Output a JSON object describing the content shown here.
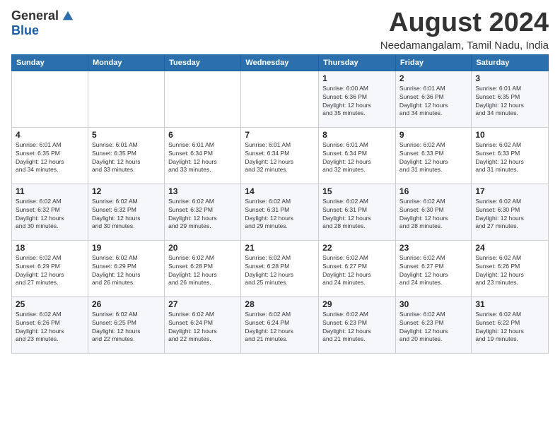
{
  "header": {
    "logo_general": "General",
    "logo_blue": "Blue",
    "month": "August 2024",
    "location": "Needamangalam, Tamil Nadu, India"
  },
  "weekdays": [
    "Sunday",
    "Monday",
    "Tuesday",
    "Wednesday",
    "Thursday",
    "Friday",
    "Saturday"
  ],
  "weeks": [
    [
      {
        "day": "",
        "info": ""
      },
      {
        "day": "",
        "info": ""
      },
      {
        "day": "",
        "info": ""
      },
      {
        "day": "",
        "info": ""
      },
      {
        "day": "1",
        "info": "Sunrise: 6:00 AM\nSunset: 6:36 PM\nDaylight: 12 hours\nand 35 minutes."
      },
      {
        "day": "2",
        "info": "Sunrise: 6:01 AM\nSunset: 6:36 PM\nDaylight: 12 hours\nand 34 minutes."
      },
      {
        "day": "3",
        "info": "Sunrise: 6:01 AM\nSunset: 6:35 PM\nDaylight: 12 hours\nand 34 minutes."
      }
    ],
    [
      {
        "day": "4",
        "info": "Sunrise: 6:01 AM\nSunset: 6:35 PM\nDaylight: 12 hours\nand 34 minutes."
      },
      {
        "day": "5",
        "info": "Sunrise: 6:01 AM\nSunset: 6:35 PM\nDaylight: 12 hours\nand 33 minutes."
      },
      {
        "day": "6",
        "info": "Sunrise: 6:01 AM\nSunset: 6:34 PM\nDaylight: 12 hours\nand 33 minutes."
      },
      {
        "day": "7",
        "info": "Sunrise: 6:01 AM\nSunset: 6:34 PM\nDaylight: 12 hours\nand 32 minutes."
      },
      {
        "day": "8",
        "info": "Sunrise: 6:01 AM\nSunset: 6:34 PM\nDaylight: 12 hours\nand 32 minutes."
      },
      {
        "day": "9",
        "info": "Sunrise: 6:02 AM\nSunset: 6:33 PM\nDaylight: 12 hours\nand 31 minutes."
      },
      {
        "day": "10",
        "info": "Sunrise: 6:02 AM\nSunset: 6:33 PM\nDaylight: 12 hours\nand 31 minutes."
      }
    ],
    [
      {
        "day": "11",
        "info": "Sunrise: 6:02 AM\nSunset: 6:32 PM\nDaylight: 12 hours\nand 30 minutes."
      },
      {
        "day": "12",
        "info": "Sunrise: 6:02 AM\nSunset: 6:32 PM\nDaylight: 12 hours\nand 30 minutes."
      },
      {
        "day": "13",
        "info": "Sunrise: 6:02 AM\nSunset: 6:32 PM\nDaylight: 12 hours\nand 29 minutes."
      },
      {
        "day": "14",
        "info": "Sunrise: 6:02 AM\nSunset: 6:31 PM\nDaylight: 12 hours\nand 29 minutes."
      },
      {
        "day": "15",
        "info": "Sunrise: 6:02 AM\nSunset: 6:31 PM\nDaylight: 12 hours\nand 28 minutes."
      },
      {
        "day": "16",
        "info": "Sunrise: 6:02 AM\nSunset: 6:30 PM\nDaylight: 12 hours\nand 28 minutes."
      },
      {
        "day": "17",
        "info": "Sunrise: 6:02 AM\nSunset: 6:30 PM\nDaylight: 12 hours\nand 27 minutes."
      }
    ],
    [
      {
        "day": "18",
        "info": "Sunrise: 6:02 AM\nSunset: 6:29 PM\nDaylight: 12 hours\nand 27 minutes."
      },
      {
        "day": "19",
        "info": "Sunrise: 6:02 AM\nSunset: 6:29 PM\nDaylight: 12 hours\nand 26 minutes."
      },
      {
        "day": "20",
        "info": "Sunrise: 6:02 AM\nSunset: 6:28 PM\nDaylight: 12 hours\nand 26 minutes."
      },
      {
        "day": "21",
        "info": "Sunrise: 6:02 AM\nSunset: 6:28 PM\nDaylight: 12 hours\nand 25 minutes."
      },
      {
        "day": "22",
        "info": "Sunrise: 6:02 AM\nSunset: 6:27 PM\nDaylight: 12 hours\nand 24 minutes."
      },
      {
        "day": "23",
        "info": "Sunrise: 6:02 AM\nSunset: 6:27 PM\nDaylight: 12 hours\nand 24 minutes."
      },
      {
        "day": "24",
        "info": "Sunrise: 6:02 AM\nSunset: 6:26 PM\nDaylight: 12 hours\nand 23 minutes."
      }
    ],
    [
      {
        "day": "25",
        "info": "Sunrise: 6:02 AM\nSunset: 6:26 PM\nDaylight: 12 hours\nand 23 minutes."
      },
      {
        "day": "26",
        "info": "Sunrise: 6:02 AM\nSunset: 6:25 PM\nDaylight: 12 hours\nand 22 minutes."
      },
      {
        "day": "27",
        "info": "Sunrise: 6:02 AM\nSunset: 6:24 PM\nDaylight: 12 hours\nand 22 minutes."
      },
      {
        "day": "28",
        "info": "Sunrise: 6:02 AM\nSunset: 6:24 PM\nDaylight: 12 hours\nand 21 minutes."
      },
      {
        "day": "29",
        "info": "Sunrise: 6:02 AM\nSunset: 6:23 PM\nDaylight: 12 hours\nand 21 minutes."
      },
      {
        "day": "30",
        "info": "Sunrise: 6:02 AM\nSunset: 6:23 PM\nDaylight: 12 hours\nand 20 minutes."
      },
      {
        "day": "31",
        "info": "Sunrise: 6:02 AM\nSunset: 6:22 PM\nDaylight: 12 hours\nand 19 minutes."
      }
    ]
  ]
}
